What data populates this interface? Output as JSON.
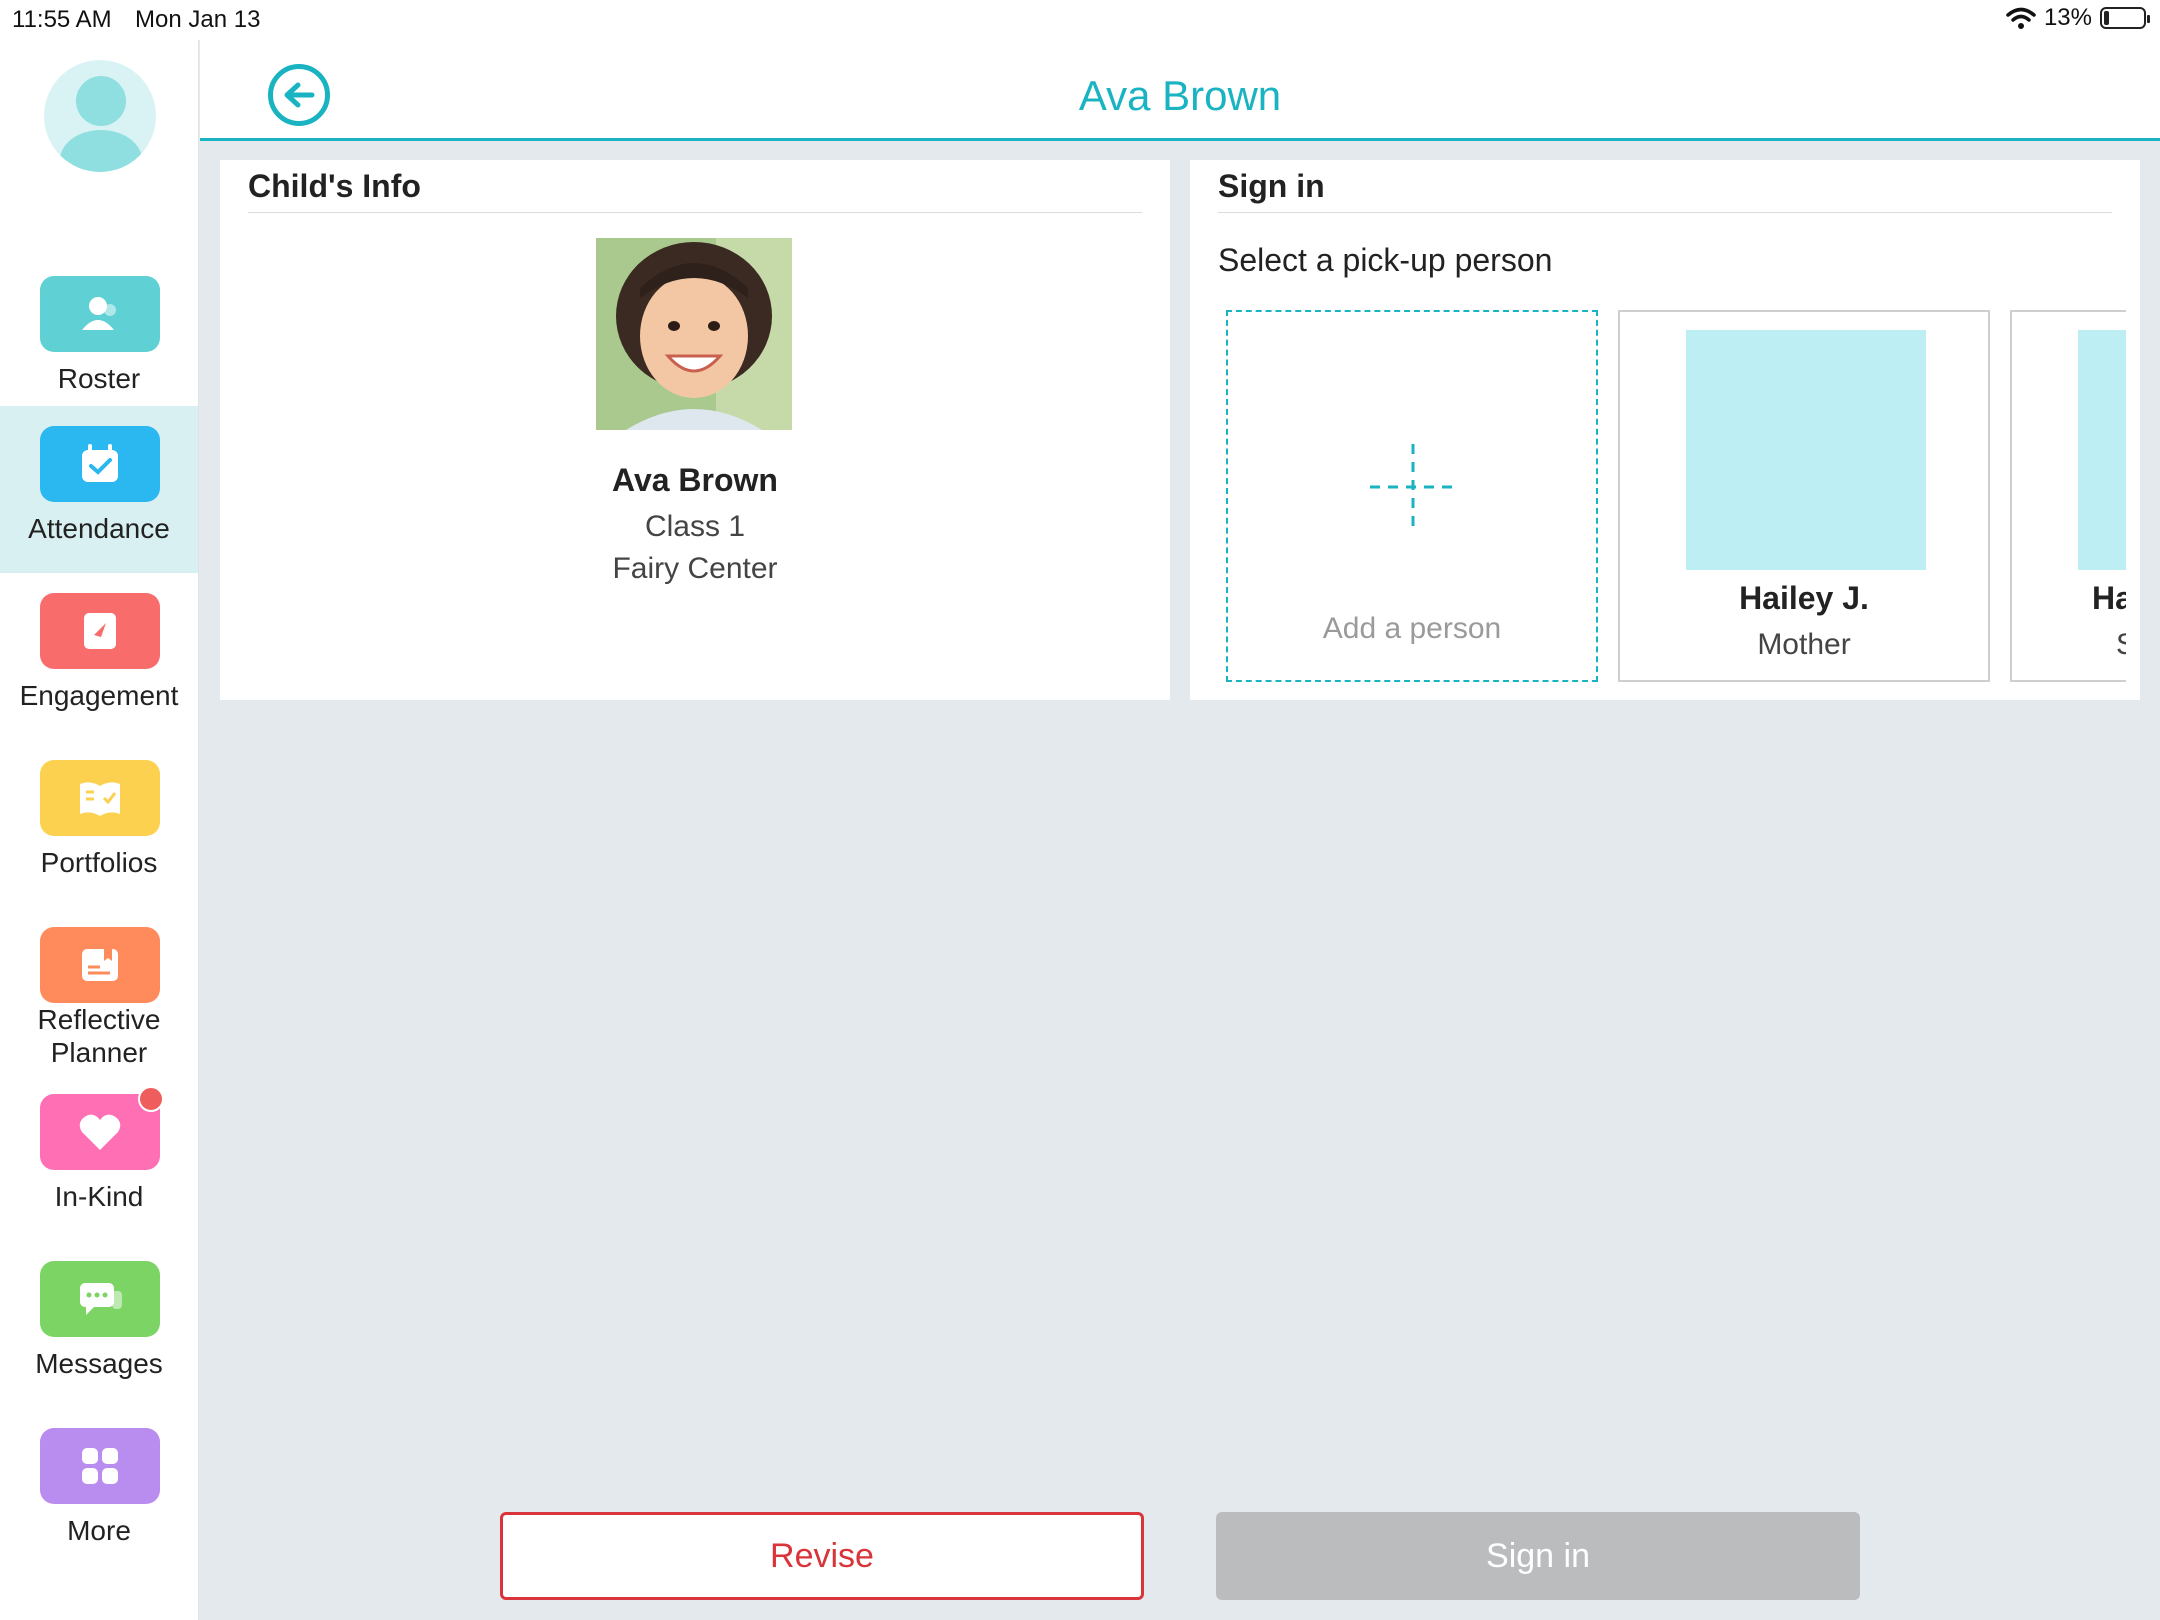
{
  "status_bar": {
    "time": "11:55 AM",
    "date": "Mon Jan 13",
    "battery": "13%"
  },
  "colors": {
    "accent": "#1ab3c2",
    "danger": "#d9343a",
    "disabled": "#babcbe"
  },
  "sidebar": {
    "items": [
      {
        "label": "Roster",
        "icon": "roster-icon",
        "color": "#5fd0d4"
      },
      {
        "label": "Attendance",
        "icon": "attendance-icon",
        "color": "#2bb7ef",
        "active": true
      },
      {
        "label": "Engagement",
        "icon": "engagement-icon",
        "color": "#f86c6c"
      },
      {
        "label": "Portfolios",
        "icon": "portfolios-icon",
        "color": "#fbd14f"
      },
      {
        "label": "Reflective Planner",
        "icon": "planner-icon",
        "color": "#ff8a5c"
      },
      {
        "label": "In-Kind",
        "icon": "heart-icon",
        "color": "#ff6fb4",
        "badge": true
      },
      {
        "label": "Messages",
        "icon": "messages-icon",
        "color": "#7cd465"
      },
      {
        "label": "More",
        "icon": "more-icon",
        "color": "#b98cef"
      }
    ]
  },
  "header": {
    "title": "Ava Brown"
  },
  "child_info": {
    "title": "Child's Info",
    "name": "Ava Brown",
    "class": "Class 1",
    "center": "Fairy Center"
  },
  "sign_in_panel": {
    "title": "Sign in",
    "prompt": "Select a pick-up person",
    "add_person": "Add a person",
    "persons": [
      {
        "name": "Hailey J.",
        "role": "Mother"
      },
      {
        "name": "Ha",
        "role": "S"
      }
    ]
  },
  "actions": {
    "revise": "Revise",
    "sign_in": "Sign in"
  }
}
